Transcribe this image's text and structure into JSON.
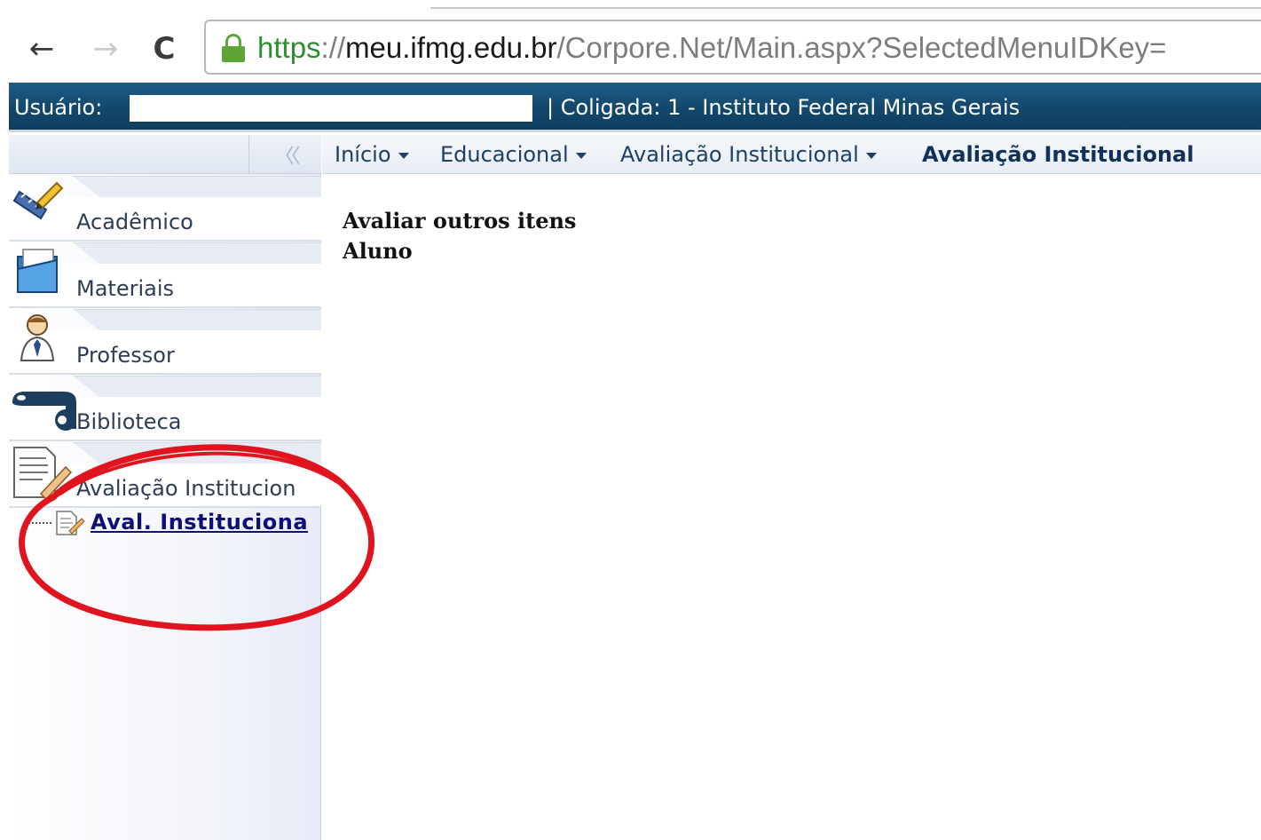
{
  "browser": {
    "url_scheme": "https",
    "url_sep": "://",
    "url_host": "meu.ifmg.edu.br",
    "url_path": "/Corpore.Net/Main.aspx?SelectedMenuIDKey=",
    "back_glyph": "←",
    "forward_glyph": "→",
    "reload_glyph": "C"
  },
  "header": {
    "user_label": "Usuário:",
    "user_value": "",
    "coligada": "|  Coligada: 1 - Instituto Federal Minas Gerais"
  },
  "sidebar": {
    "collapse_glyph": "〈〈",
    "modules": [
      {
        "label": "Acadêmico",
        "icon": "ruler-pencil-icon"
      },
      {
        "label": "Materiais",
        "icon": "folder-icon"
      },
      {
        "label": "Professor",
        "icon": "teacher-icon"
      },
      {
        "label": "Biblioteca",
        "icon": "scroll-icon"
      },
      {
        "label": "Avaliação Institucion",
        "icon": "document-pencil-icon"
      }
    ],
    "tree_link": "Aval. Institucionа"
  },
  "breadcrumb": {
    "items": [
      "Início",
      "Educacional",
      "Avaliação Institucional"
    ],
    "current": "Avaliação Institucional"
  },
  "main": {
    "line1": "Avaliar outros itens",
    "line2": "Aluno"
  },
  "colors": {
    "header_bar": "#144a6f",
    "annotation_red": "#e0141e",
    "link": "#0f0f7a"
  }
}
